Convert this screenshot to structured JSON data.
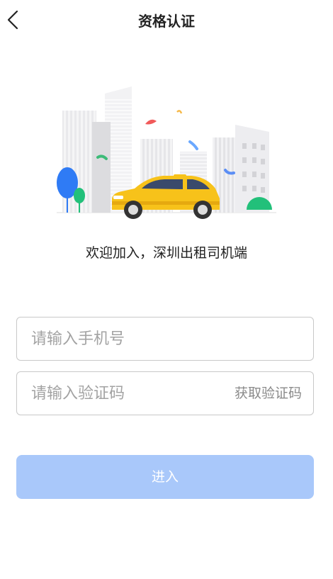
{
  "header": {
    "title": "资格认证"
  },
  "welcome_text": "欢迎加入，深圳出租司机端",
  "form": {
    "phone_placeholder": "请输入手机号",
    "code_placeholder": "请输入验证码",
    "get_code_label": "获取验证码",
    "submit_label": "进入"
  },
  "colors": {
    "button_disabled": "#a9c8fa",
    "taxi_yellow": "#f7c21a",
    "tree_blue": "#2f7bf5",
    "tree_green": "#22c07a"
  },
  "icons": {
    "back": "chevron-left-icon"
  }
}
